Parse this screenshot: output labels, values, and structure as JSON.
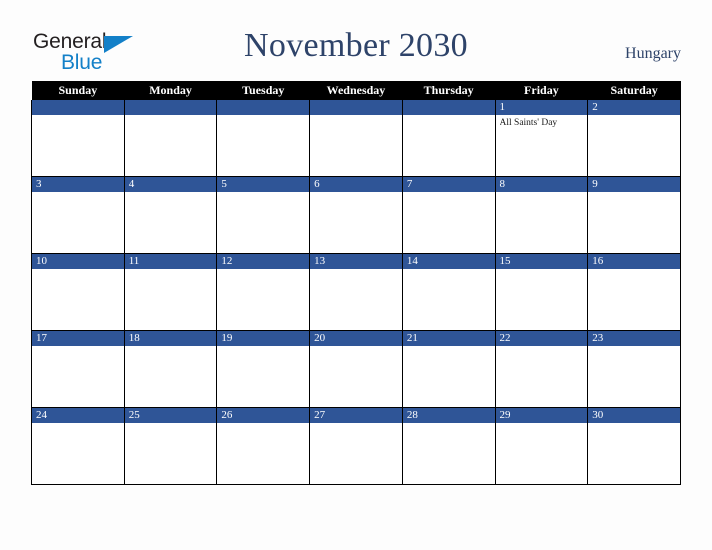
{
  "brand": {
    "line1": "General",
    "line2": "Blue",
    "triangle_color": "#1380c8",
    "line1_color": "#231f20"
  },
  "header": {
    "title": "November 2030",
    "country": "Hungary",
    "title_color": "#2e4369"
  },
  "calendar": {
    "weekday_headers": [
      "Sunday",
      "Monday",
      "Tuesday",
      "Wednesday",
      "Thursday",
      "Friday",
      "Saturday"
    ],
    "header_bg": "#000000",
    "daybar_bg": "#2f5597",
    "cell_bg": "#ffffff",
    "weeks": [
      [
        {
          "day": "",
          "events": []
        },
        {
          "day": "",
          "events": []
        },
        {
          "day": "",
          "events": []
        },
        {
          "day": "",
          "events": []
        },
        {
          "day": "",
          "events": []
        },
        {
          "day": "1",
          "events": [
            "All Saints' Day"
          ]
        },
        {
          "day": "2",
          "events": []
        }
      ],
      [
        {
          "day": "3",
          "events": []
        },
        {
          "day": "4",
          "events": []
        },
        {
          "day": "5",
          "events": []
        },
        {
          "day": "6",
          "events": []
        },
        {
          "day": "7",
          "events": []
        },
        {
          "day": "8",
          "events": []
        },
        {
          "day": "9",
          "events": []
        }
      ],
      [
        {
          "day": "10",
          "events": []
        },
        {
          "day": "11",
          "events": []
        },
        {
          "day": "12",
          "events": []
        },
        {
          "day": "13",
          "events": []
        },
        {
          "day": "14",
          "events": []
        },
        {
          "day": "15",
          "events": []
        },
        {
          "day": "16",
          "events": []
        }
      ],
      [
        {
          "day": "17",
          "events": []
        },
        {
          "day": "18",
          "events": []
        },
        {
          "day": "19",
          "events": []
        },
        {
          "day": "20",
          "events": []
        },
        {
          "day": "21",
          "events": []
        },
        {
          "day": "22",
          "events": []
        },
        {
          "day": "23",
          "events": []
        }
      ],
      [
        {
          "day": "24",
          "events": []
        },
        {
          "day": "25",
          "events": []
        },
        {
          "day": "26",
          "events": []
        },
        {
          "day": "27",
          "events": []
        },
        {
          "day": "28",
          "events": []
        },
        {
          "day": "29",
          "events": []
        },
        {
          "day": "30",
          "events": []
        }
      ]
    ]
  }
}
